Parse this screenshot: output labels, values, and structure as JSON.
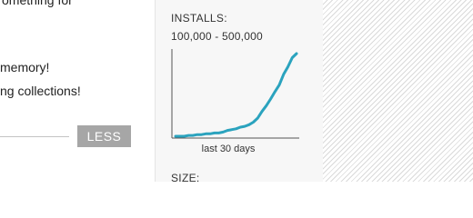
{
  "description": {
    "lines": [
      "omething for",
      "memory!",
      "ng collections!"
    ],
    "less_label": "LESS"
  },
  "stats": {
    "installs_label": "INSTALLS:",
    "installs_value": "100,000 - 500,000",
    "size_label": "SIZE:",
    "chart_caption": "last 30 days"
  },
  "colors": {
    "line": "#2ba3be",
    "axis": "#555555",
    "button": "#a6a6a6"
  },
  "chart_data": {
    "type": "line",
    "xlabel": "last 30 days",
    "series": [
      {
        "values": [
          0,
          0,
          0,
          1,
          1,
          2,
          2,
          3,
          3,
          4,
          4,
          5,
          7,
          8,
          9,
          11,
          12,
          14,
          17,
          22,
          30,
          37,
          45,
          54,
          62,
          75,
          84,
          95,
          100
        ]
      }
    ],
    "ylim": [
      0,
      100
    ]
  }
}
